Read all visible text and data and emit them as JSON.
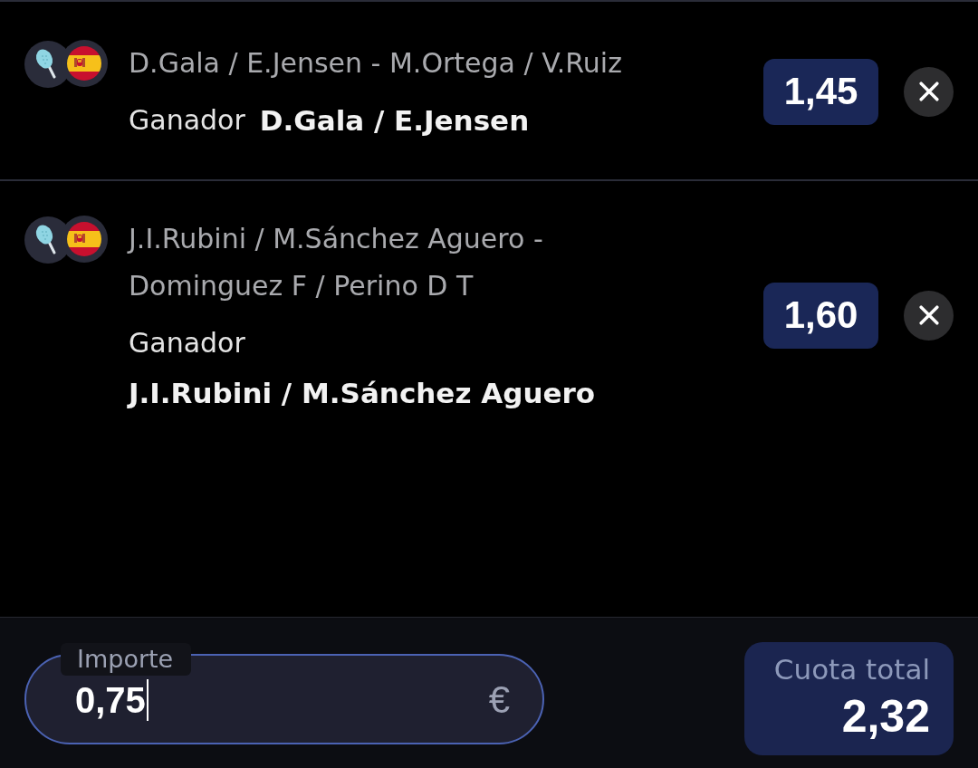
{
  "bets": [
    {
      "event": "D.Gala / E.Jensen - M.Ortega / V.Ruiz",
      "market": "Ganador",
      "selection": "D.Gala / E.Jensen",
      "odds": "1,45"
    },
    {
      "event": "J.I.Rubini / M.Sánchez Aguero - Dominguez F / Perino D T",
      "market": "Ganador",
      "selection": "J.I.Rubini / M.Sánchez Aguero",
      "odds": "1,60"
    }
  ],
  "stake": {
    "label": "Importe",
    "value": "0,75",
    "currency": "€",
    "focused": true
  },
  "total_odds": {
    "label": "Cuota total",
    "value": "2,32"
  }
}
